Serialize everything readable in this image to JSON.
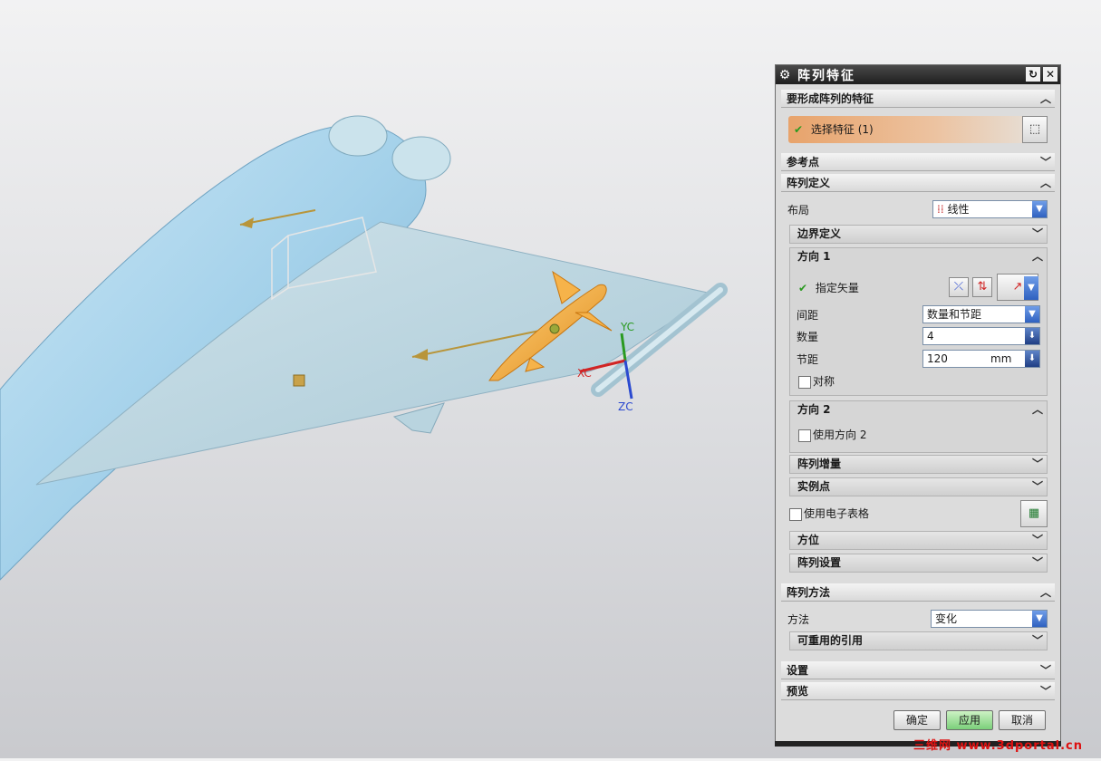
{
  "dialog": {
    "title": "阵列特征",
    "features_section": "要形成阵列的特征",
    "select_feature": "选择特征 (1)",
    "reference_point": "参考点",
    "array_definition": "阵列定义",
    "layout_label": "布局",
    "layout_value": "线性",
    "boundary_definition": "边界定义",
    "direction1": {
      "header": "方向 1",
      "specify_vector": "指定矢量",
      "spacing_label": "间距",
      "spacing_value": "数量和节距",
      "count_label": "数量",
      "count_value": "4",
      "pitch_label": "节距",
      "pitch_value": "120",
      "pitch_unit": "mm",
      "symmetric_label": "对称"
    },
    "direction2": {
      "header": "方向 2",
      "use_direction2": "使用方向 2"
    },
    "array_increment": "阵列增量",
    "instance_points": "实例点",
    "use_spreadsheet": "使用电子表格",
    "orientation": "方位",
    "array_settings": "阵列设置",
    "array_method": "阵列方法",
    "method_label": "方法",
    "method_value": "变化",
    "reusable_references": "可重用的引用",
    "settings": "设置",
    "preview": "预览",
    "ok_label": "确定",
    "apply_label": "应用",
    "cancel_label": "取消"
  },
  "viewport": {
    "axis_x": "XC",
    "axis_y": "YC",
    "axis_z": "ZC",
    "colors": {
      "aircraft": "#a9d6ee",
      "wing": "#bcd8e3",
      "missile": "#f2a531"
    }
  },
  "watermark": "三维网 www.3dportal.cn"
}
